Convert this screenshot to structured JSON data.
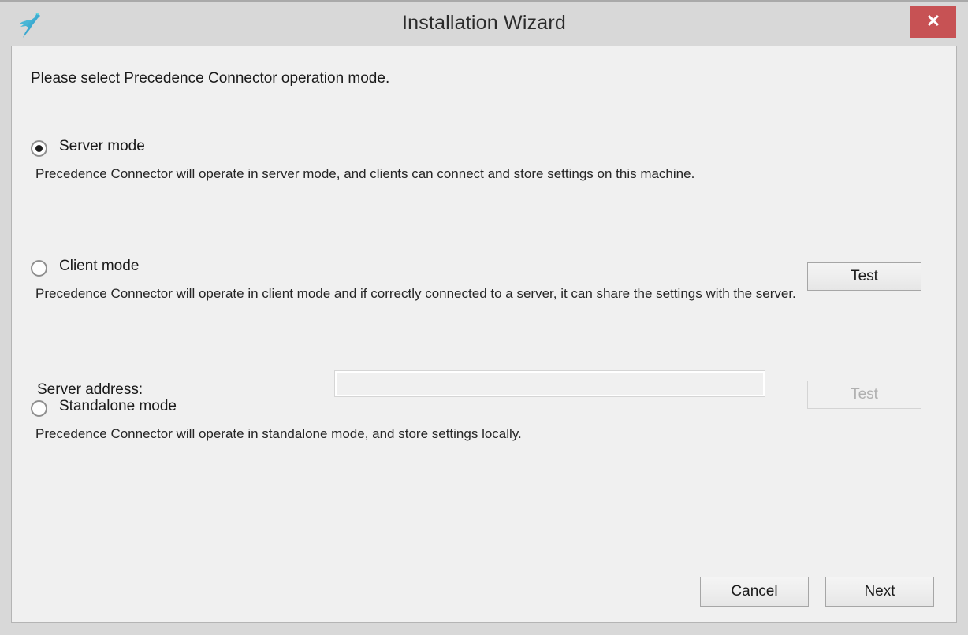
{
  "window": {
    "title": "Installation Wizard",
    "close_label": "✕",
    "app_icon": "bird-logo-icon",
    "accent_close_color": "#c75254",
    "logo_colors": [
      "#3fc6dd",
      "#4aa8cf",
      "#2f8fbf"
    ]
  },
  "content": {
    "intro": "Please select Precedence Connector operation mode."
  },
  "options": [
    {
      "id": "server",
      "label": "Server mode",
      "selected": true,
      "description": "Precedence Connector will operate in server mode, and clients can connect and store settings on this machine."
    },
    {
      "id": "client",
      "label": "Client mode",
      "selected": false,
      "description": "Precedence Connector will operate in client mode and if correctly connected to a server, it can share the settings with the server."
    },
    {
      "id": "standalone",
      "label": "Standalone mode",
      "selected": false,
      "description": "Precedence Connector will operate in standalone mode, and store settings locally."
    }
  ],
  "server_address": {
    "label": "Server address:",
    "value": "",
    "placeholder": ""
  },
  "buttons": {
    "test_server": "Test",
    "test_client": "Test",
    "cancel": "Cancel",
    "next": "Next"
  }
}
